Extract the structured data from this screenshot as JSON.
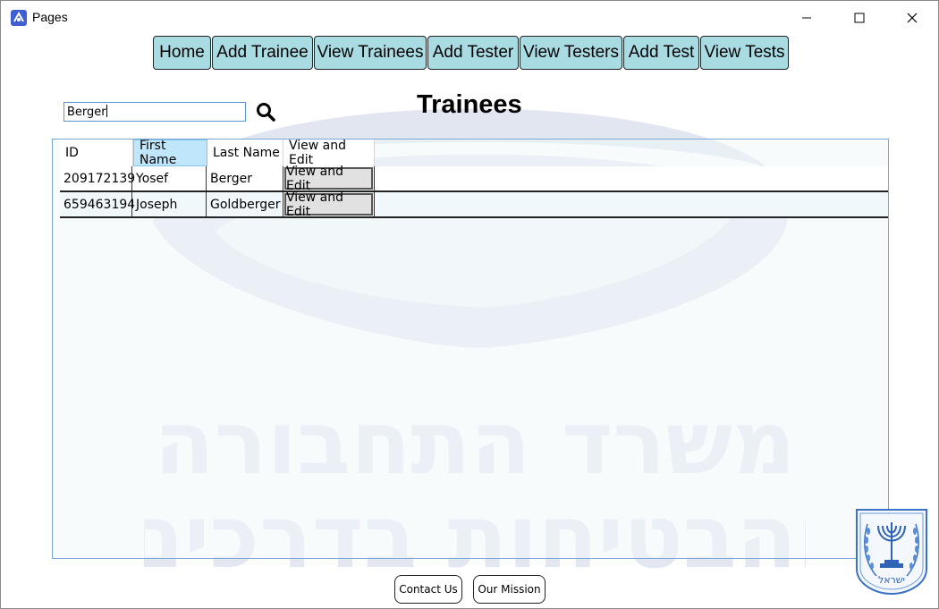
{
  "window": {
    "title": "Pages"
  },
  "nav": {
    "items": [
      {
        "label": "Home"
      },
      {
        "label": "Add Trainee"
      },
      {
        "label": "View Trainees"
      },
      {
        "label": "Add Tester"
      },
      {
        "label": "View Testers"
      },
      {
        "label": "Add Test"
      },
      {
        "label": "View Tests"
      }
    ]
  },
  "page": {
    "heading": "Trainees"
  },
  "search": {
    "value": "Berger"
  },
  "table": {
    "columns": [
      "ID",
      "First Name",
      "Last Name",
      "View and Edit"
    ],
    "active_column": "First Name",
    "rows": [
      {
        "id": "209172139",
        "first_name": "Yosef",
        "last_name": "Berger",
        "action": "View and Edit"
      },
      {
        "id": "659463194",
        "first_name": "Joseph",
        "last_name": "Goldberger",
        "action": "View and Edit"
      }
    ]
  },
  "watermark": {
    "line1": "משרד התחבורה",
    "line2": "והבטיחות בדרכים"
  },
  "emblem": {
    "text": "ישראל"
  },
  "footer": {
    "contact_label": "Contact Us",
    "mission_label": "Our Mission"
  },
  "colors": {
    "nav_button": "#a9dbe3",
    "accent_border": "#7aa6d8",
    "active_header": "#bfe6fb"
  }
}
